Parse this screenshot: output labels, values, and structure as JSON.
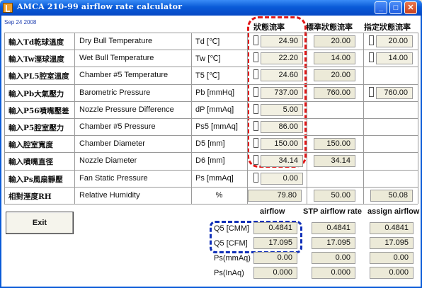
{
  "window": {
    "title": "AMCA 210-99 airflow rate calculator",
    "date": "Sep 24 2008",
    "minimize_icon": "minimize-icon",
    "maximize_icon": "maximize-icon",
    "close_icon": "close-icon",
    "app_icon": "app-icon"
  },
  "columns": {
    "state": "狀態流率",
    "std_state": "標準狀態流率",
    "assign_state": "指定狀態流率"
  },
  "rows": [
    {
      "zh": "輸入Td乾球溫度",
      "en": "Dry Bull Temperature",
      "unit": "Td [℃]",
      "value": "24.90",
      "std": "20.00",
      "assign": "20.00"
    },
    {
      "zh": "輸入Tw溼球溫度",
      "en": "Wet Bull Temperature",
      "unit": "Tw [℃]",
      "value": "22.20",
      "std": "14.00",
      "assign": "14.00"
    },
    {
      "zh": "輸入PL5腔室溫度",
      "en": "Chamber #5 Temperature",
      "unit": "T5 [℃]",
      "value": "24.60",
      "std": "20.00",
      "assign": ""
    },
    {
      "zh": "輸入Pb大氣壓力",
      "en": "Barometric Pressure",
      "unit": "Pb [mmHq]",
      "value": "737.00",
      "std": "760.00",
      "assign": "760.00"
    },
    {
      "zh": "輸入P56噴嘴壓差",
      "en": "Nozzle Pressure Difference",
      "unit": "dP [mmAq]",
      "value": "5.00",
      "std": "",
      "assign": ""
    },
    {
      "zh": "輸入P5腔室壓力",
      "en": "Chamber #5 Pressure",
      "unit": "Ps5 [mmAq]",
      "value": "86.00",
      "std": "",
      "assign": ""
    },
    {
      "zh": "輸入腔室寬度",
      "en": "Chamber Diameter",
      "unit": "D5 [mm]",
      "value": "150.00",
      "std": "150.00",
      "assign": ""
    },
    {
      "zh": "輸入噴嘴直徑",
      "en": "Nozzle Diameter",
      "unit": "D6 [mm]",
      "value": "34.14",
      "std": "34.14",
      "assign": ""
    },
    {
      "zh": "輸入Ps風扇靜壓",
      "en": "Fan Static Pressure",
      "unit": "Ps [mmAq]",
      "value": "0.00",
      "std": "",
      "assign": ""
    },
    {
      "zh": "相對溼度RH",
      "en": "Relative Humidity",
      "unit": "%",
      "value": "79.80",
      "std": "50.00",
      "assign": "50.08"
    }
  ],
  "exit_label": "Exit",
  "results": {
    "headers": {
      "airflow": "airflow",
      "stp": "STP airflow rate",
      "assign": "assign airflow"
    },
    "rows": [
      {
        "label": "Q5 [CMM]",
        "airflow": "0.4841",
        "stp": "0.4841",
        "assign": "0.4841"
      },
      {
        "label": "Q5 [CFM]",
        "airflow": "17.095",
        "stp": "17.095",
        "assign": "17.095"
      },
      {
        "label": "Ps(mmAq)",
        "airflow": "0.00",
        "stp": "0.00",
        "assign": "0.00"
      },
      {
        "label": "Ps(InAq)",
        "airflow": "0.000",
        "stp": "0.000",
        "assign": "0.000"
      }
    ]
  },
  "colors": {
    "title_bar": "#0A5BD8",
    "red_highlight": "#E01818",
    "blue_highlight": "#1030B8",
    "field_bg": "#F2F0E2"
  }
}
